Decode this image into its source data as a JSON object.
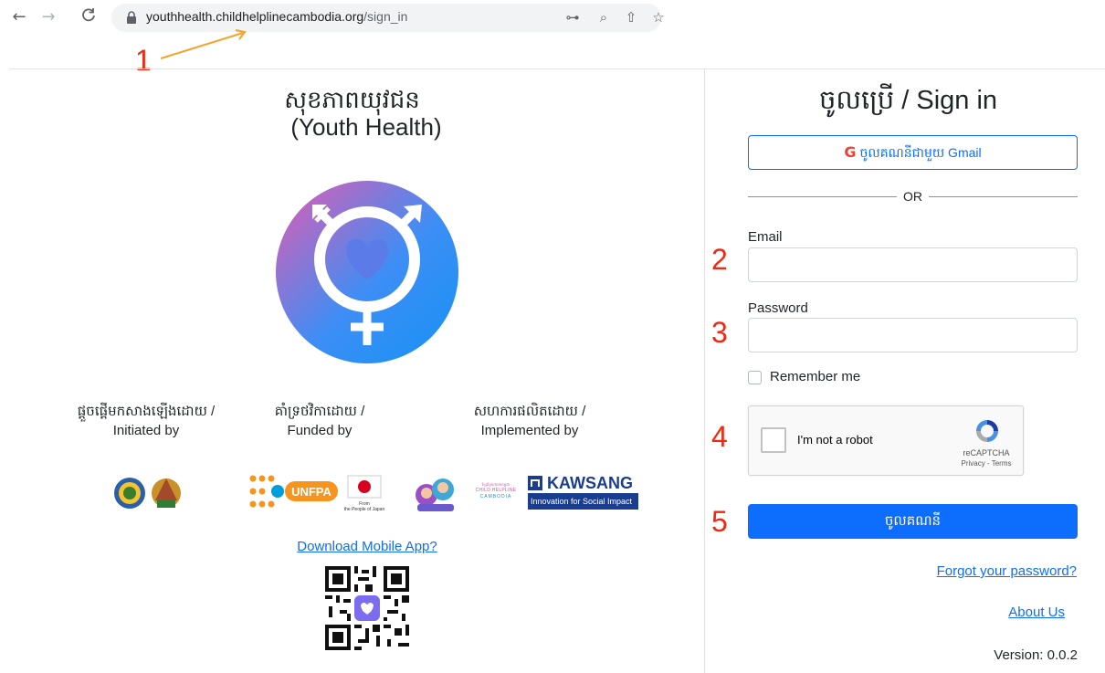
{
  "browser": {
    "url_host": "youthhealth.childhelplinecambodia.org",
    "url_path": "/sign_in",
    "back_glyph": "←",
    "forward_glyph": "→",
    "reload_glyph": "C",
    "key_glyph": "⊶",
    "zoom_glyph": "⌕",
    "share_glyph": "⇧",
    "star_glyph": "☆"
  },
  "annotations": [
    "1",
    "2",
    "3",
    "4",
    "5"
  ],
  "annotation_color": "#ee2a12",
  "brand": {
    "title_khmer": "សុខភាពយុវជន",
    "subtitle": "(Youth Health)",
    "logo_colors": [
      "#d45fb4",
      "#1e90ff"
    ]
  },
  "credits": {
    "initiated": {
      "khmer": "ផ្តួចផ្តើមកសាងឡើងដោយ /",
      "english": "Initiated by"
    },
    "funded": {
      "khmer": "គាំទ្រថវិកាដោយ /",
      "english": "Funded by"
    },
    "implemented": {
      "khmer": "សហការផលិតដោយ /",
      "english": "Implemented by"
    }
  },
  "partners": {
    "unfpa": "UNFPA",
    "japan_caption_1": "From",
    "japan_caption_2": "the People of Japan",
    "childhelpline_khmer": "ខ្សែជំនួយកុមារកម្ពុជា",
    "childhelpline": "CHILD HELPLINE",
    "childhelpline_country": "CAMBODIA",
    "kawsang": "KAWSANG",
    "kawsang_tagline": "Innovation for Social Impact"
  },
  "download_link": "Download Mobile App?",
  "signin": {
    "title": "ចូលប្រើ / Sign in",
    "gmail_button": "ចូលគណនីជាមួយ Gmail",
    "gmail_icon_letter": "G",
    "or": "OR",
    "email_label": "Email",
    "email_value": "",
    "password_label": "Password",
    "password_value": "",
    "remember_label": "Remember me",
    "captcha_text": "I'm not a robot",
    "captcha_brand": "reCAPTCHA",
    "captcha_links": "Privacy - Terms",
    "submit_button": "ចូលគណនី",
    "forgot_link": "Forgot your password?",
    "about_link": "About Us",
    "version": "Version: 0.0.2"
  },
  "colors": {
    "primary": "#0d6efd",
    "or_line": "#20c997"
  }
}
